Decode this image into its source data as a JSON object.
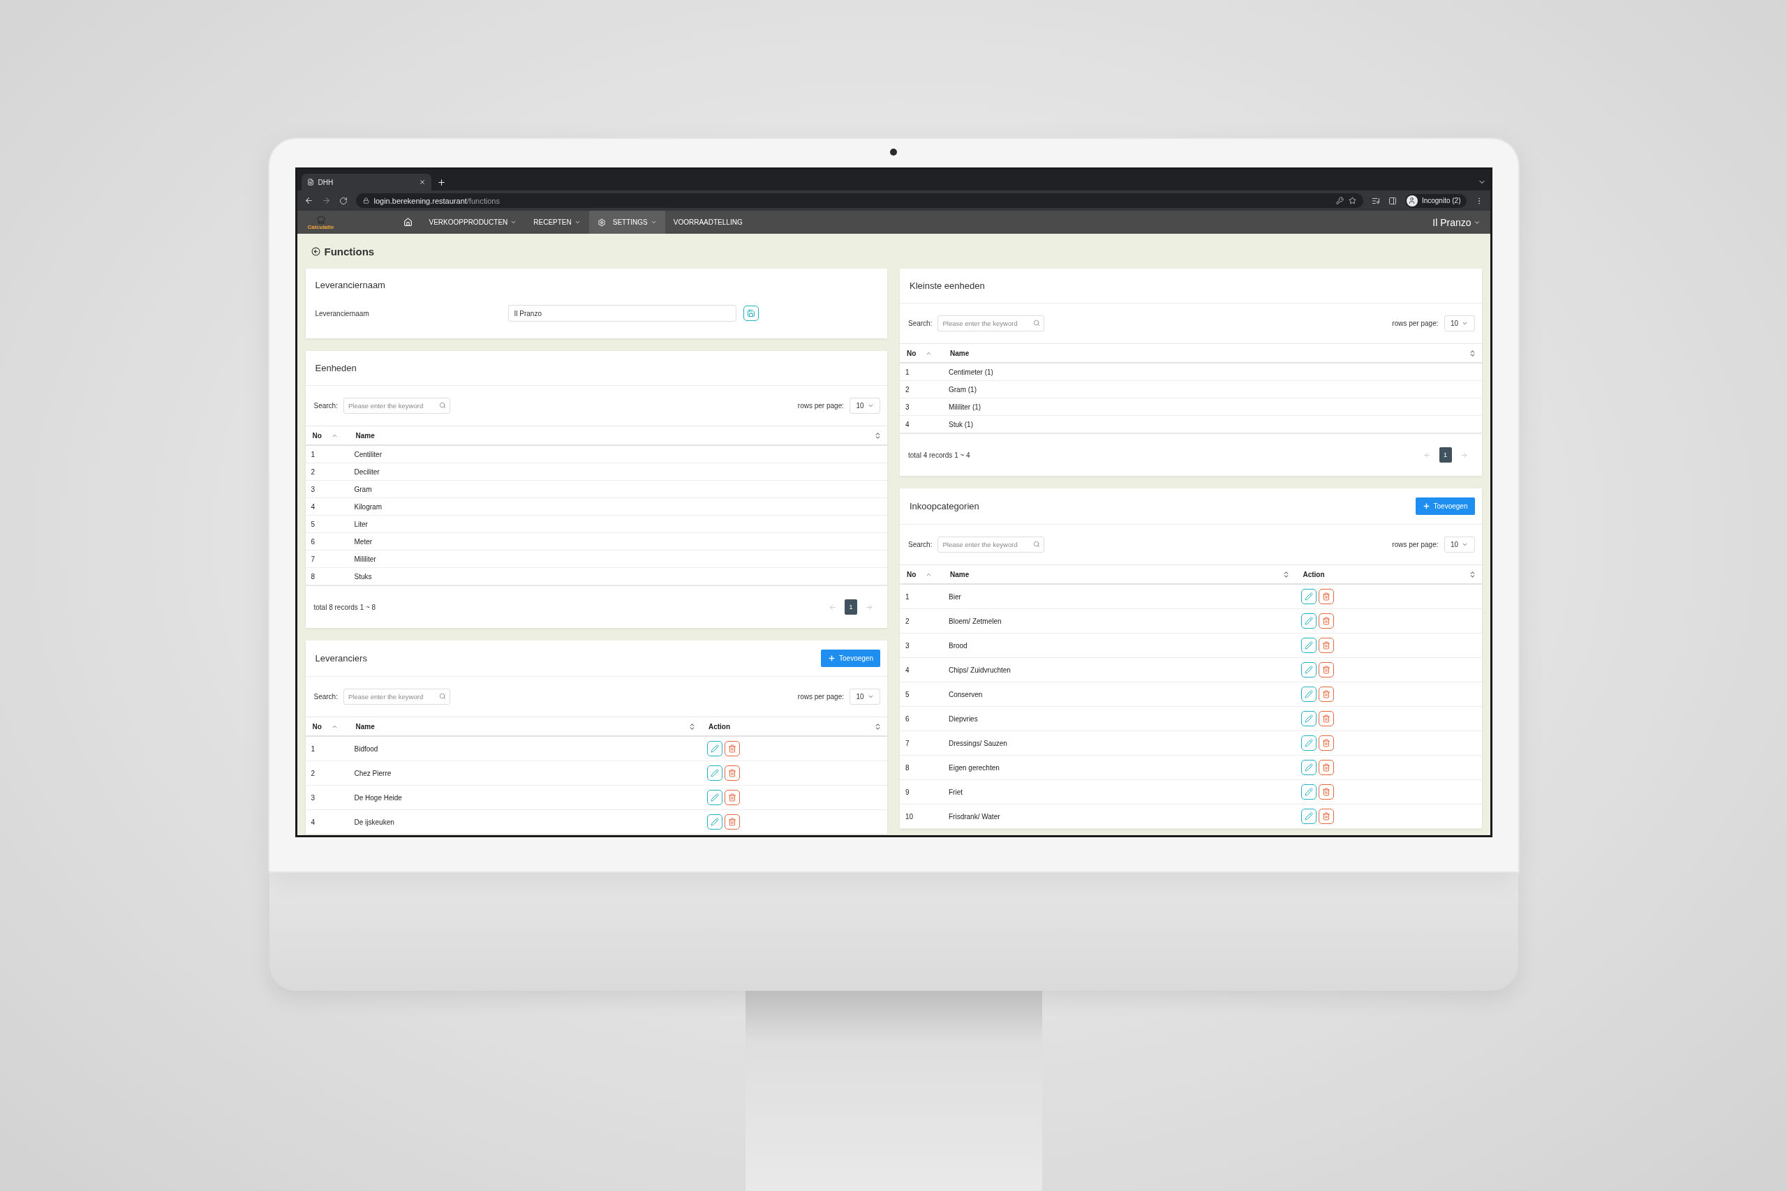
{
  "browser": {
    "tab_title": "DHH",
    "url_host": "login.berekening.restaurant",
    "url_path": "/functions",
    "profile": "Incognito (2)"
  },
  "nav": {
    "logo": "Calculatie",
    "items": [
      {
        "kind": "home",
        "selected": false
      },
      {
        "kind": "menu",
        "label": "VERKOOPPRODUCTEN",
        "dropdown": true,
        "selected": false
      },
      {
        "kind": "menu",
        "label": "RECEPTEN",
        "dropdown": true,
        "selected": false
      },
      {
        "kind": "settings",
        "label": "SETTINGS",
        "dropdown": true,
        "selected": true
      },
      {
        "kind": "menu",
        "label": "VOORRAADTELLING",
        "dropdown": false,
        "selected": false
      }
    ],
    "user": "Il Pranzo"
  },
  "page_title": "Functions",
  "name_card": {
    "title": "Leveranciernaam",
    "label": "Leveranciernaam",
    "value": "Il Pranzo"
  },
  "left_panels": [
    {
      "title": "Eenheden",
      "search_label": "Search:",
      "search_placeholder": "Please enter the keyword",
      "rows_label": "rows per page:",
      "rows_value": "10",
      "columns": [
        {
          "label": "No",
          "sorted": true
        },
        {
          "label": "Name",
          "sorted": false
        }
      ],
      "rows": [
        {
          "no": "1",
          "name": "Centiliter"
        },
        {
          "no": "2",
          "name": "Deciliter"
        },
        {
          "no": "3",
          "name": "Gram"
        },
        {
          "no": "4",
          "name": "Kilogram"
        },
        {
          "no": "5",
          "name": "Liter"
        },
        {
          "no": "6",
          "name": "Meter"
        },
        {
          "no": "7",
          "name": "Mililiter"
        },
        {
          "no": "8",
          "name": "Stuks"
        }
      ],
      "footer": {
        "total": "total 8 records 1 ~ 8",
        "pages": [
          {
            "label": "1",
            "selected": true
          }
        ]
      }
    },
    {
      "title": "Leveranciers",
      "add_button": "Toevoegen",
      "search_label": "Search:",
      "search_placeholder": "Please enter the keyword",
      "rows_label": "rows per page:",
      "rows_value": "10",
      "columns": [
        {
          "label": "No",
          "sorted": true
        },
        {
          "label": "Name",
          "sorted": false
        },
        {
          "label": "Action",
          "sorted": false
        }
      ],
      "actions": true,
      "rows": [
        {
          "no": "1",
          "name": "Bidfood"
        },
        {
          "no": "2",
          "name": "Chez Pierre"
        },
        {
          "no": "3",
          "name": "De Hoge Heide"
        },
        {
          "no": "4",
          "name": "De ijskeuken"
        }
      ]
    }
  ],
  "right_panels": [
    {
      "title": "Kleinste eenheden",
      "search_label": "Search:",
      "search_placeholder": "Please enter the keyword",
      "rows_label": "rows per page:",
      "rows_value": "10",
      "columns": [
        {
          "label": "No",
          "sorted": true
        },
        {
          "label": "Name",
          "sorted": false
        }
      ],
      "rows": [
        {
          "no": "1",
          "name": "Centimeter (1)"
        },
        {
          "no": "2",
          "name": "Gram (1)"
        },
        {
          "no": "3",
          "name": "Mililiter (1)"
        },
        {
          "no": "4",
          "name": "Stuk (1)"
        }
      ],
      "footer": {
        "total": "total 4 records 1 ~ 4",
        "pages": [
          {
            "label": "1",
            "selected": true
          }
        ]
      }
    },
    {
      "title": "Inkoopcategorien",
      "add_button": "Toevoegen",
      "search_label": "Search:",
      "search_placeholder": "Please enter the keyword",
      "rows_label": "rows per page:",
      "rows_value": "10",
      "columns": [
        {
          "label": "No",
          "sorted": true
        },
        {
          "label": "Name",
          "sorted": false
        },
        {
          "label": "Action",
          "sorted": false
        }
      ],
      "actions": true,
      "rows": [
        {
          "no": "1",
          "name": "Bier"
        },
        {
          "no": "2",
          "name": "Bloem/ Zetmelen"
        },
        {
          "no": "3",
          "name": "Brood"
        },
        {
          "no": "4",
          "name": "Chips/ Zuidvruchten"
        },
        {
          "no": "5",
          "name": "Conserven"
        },
        {
          "no": "6",
          "name": "Diepvries"
        },
        {
          "no": "7",
          "name": "Dressings/ Sauzen"
        },
        {
          "no": "8",
          "name": "Eigen gerechten"
        },
        {
          "no": "9",
          "name": "Friet"
        },
        {
          "no": "10",
          "name": "Frisdrank/ Water"
        }
      ]
    }
  ]
}
